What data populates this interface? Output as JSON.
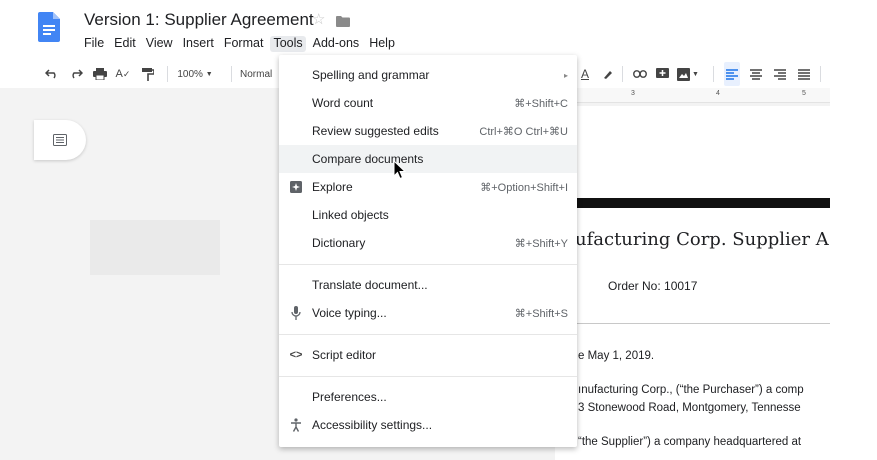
{
  "doc": {
    "title": "Version 1: Supplier Agreement"
  },
  "menubar": [
    "File",
    "Edit",
    "View",
    "Insert",
    "Format",
    "Tools",
    "Add-ons",
    "Help"
  ],
  "toolbar": {
    "zoom": "100%",
    "style": "Normal"
  },
  "ruler": {
    "marks": [
      "3",
      "4",
      "5"
    ]
  },
  "document": {
    "heading": "ufacturing Corp. Supplier A",
    "order": "Order No: 10017",
    "line1": "e May 1, 2019.",
    "line2": "ınufacturing Corp., (“the Purchaser”) a comp",
    "line3": "3 Stonewood Road, Montgomery, Tennesse",
    "line4": "“the Supplier”) a company headquartered at"
  },
  "tools_menu": [
    {
      "label": "Spelling and grammar",
      "shortcut": "▸",
      "icon": ""
    },
    {
      "label": "Word count",
      "shortcut": "⌘+Shift+C",
      "icon": ""
    },
    {
      "label": "Review suggested edits",
      "shortcut": "Ctrl+⌘O Ctrl+⌘U",
      "icon": ""
    },
    {
      "label": "Compare documents",
      "shortcut": "",
      "icon": ""
    },
    {
      "label": "Explore",
      "shortcut": "⌘+Option+Shift+I",
      "icon": "explore-icon"
    },
    {
      "label": "Linked objects",
      "shortcut": "",
      "icon": ""
    },
    {
      "label": "Dictionary",
      "shortcut": "⌘+Shift+Y",
      "icon": ""
    },
    {
      "label": "Translate document...",
      "shortcut": "",
      "icon": ""
    },
    {
      "label": "Voice typing...",
      "shortcut": "⌘+Shift+S",
      "icon": "microphone-icon"
    },
    {
      "label": "Script editor",
      "shortcut": "",
      "icon": "code-icon"
    },
    {
      "label": "Preferences...",
      "shortcut": "",
      "icon": ""
    },
    {
      "label": "Accessibility settings...",
      "shortcut": "",
      "icon": "accessibility-icon"
    }
  ],
  "colors": {
    "docs_blue": "#4285f4",
    "menu_hover": "#f1f3f4",
    "active_blue": "#1a73e8"
  }
}
